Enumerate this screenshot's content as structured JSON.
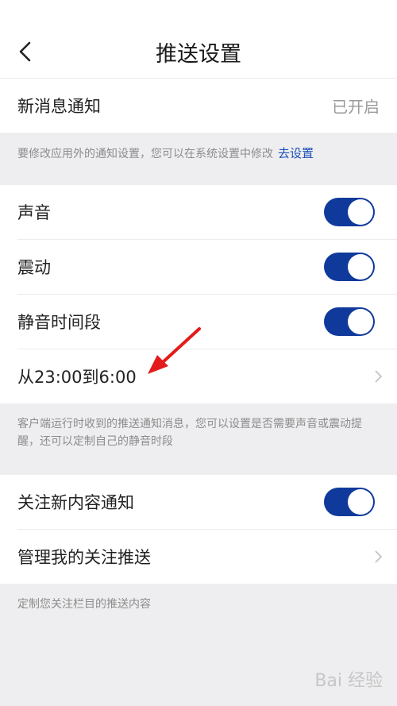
{
  "header": {
    "title": "推送设置"
  },
  "new_message": {
    "label": "新消息通知",
    "value": "已开启"
  },
  "note_system": {
    "text": "要修改应用外的通知设置，您可以在系统设置中修改",
    "link": "去设置"
  },
  "sound_settings": {
    "items": [
      {
        "label": "声音",
        "enabled": true
      },
      {
        "label": "震动",
        "enabled": true
      },
      {
        "label": "静音时间段",
        "enabled": true
      }
    ],
    "quiet_time": "从23:00到6:00"
  },
  "note_push": {
    "text": "客户端运行时收到的推送通知消息，您可以设置是否需要声音或震动提醒，还可以定制自己的静音时段"
  },
  "follow_settings": {
    "follow_label": "关注新内容通知",
    "follow_enabled": true,
    "manage_label": "管理我的关注推送"
  },
  "note_follow": {
    "text": "定制您关注栏目的推送内容"
  },
  "watermark": {
    "text": "Bai 经验"
  },
  "colors": {
    "accent": "#0f3a9c",
    "link": "#1f4fb8",
    "arrow": "#e31b1b"
  }
}
